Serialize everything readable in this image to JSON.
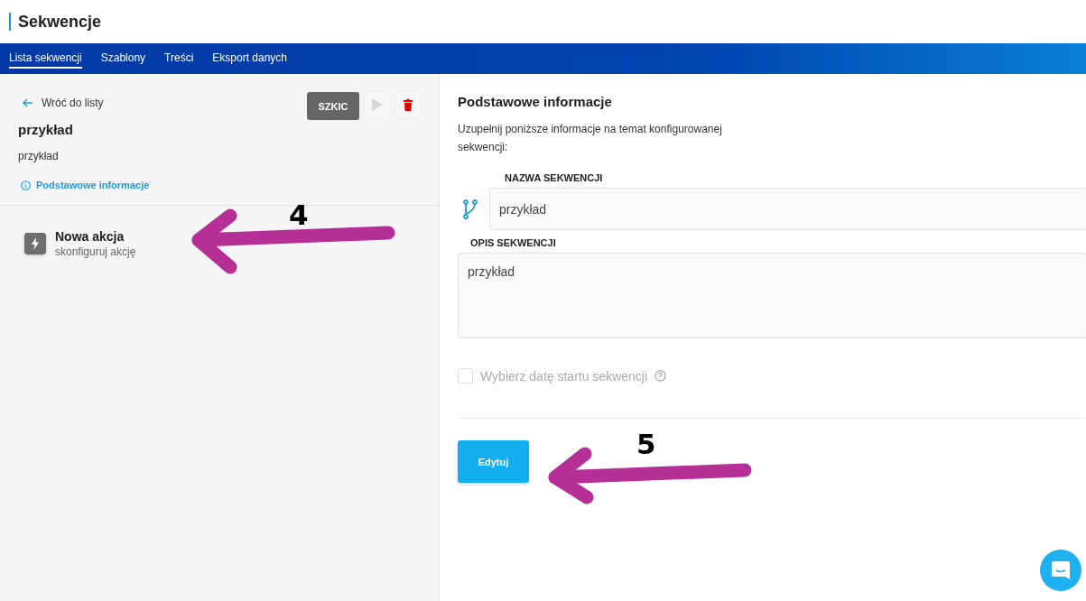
{
  "app": {
    "title": "Sekwencje"
  },
  "nav": [
    {
      "label": "Lista sekwencji",
      "selected": true
    },
    {
      "label": "Szablony",
      "selected": false
    },
    {
      "label": "Treści",
      "selected": false
    },
    {
      "label": "Eksport danych",
      "selected": false
    }
  ],
  "left": {
    "back": "Wróć do listy",
    "status_badge": "SZKIC",
    "play_disabled": true,
    "title": "przykład",
    "description": "przykład",
    "section_link": "Podstawowe informacje",
    "actions": [
      {
        "title": "Nowa akcja",
        "subtitle": "skonfiguruj akcję"
      }
    ]
  },
  "form": {
    "heading": "Podstawowe informacje",
    "intro": "Uzupełnij poniższe informacje na temat konfigurowanej sekwencji:",
    "fields": [
      {
        "kind": "input",
        "label": "NAZWA SEKWENCJI",
        "value": "przykład"
      },
      {
        "kind": "textarea",
        "label": "OPIS SEKWENCJI",
        "value": "przykład"
      }
    ],
    "start_date": {
      "label": "Wybierz datę startu sekwencji",
      "checked": false,
      "disabled": true
    },
    "submit": "Edytuj"
  },
  "annotations": [
    {
      "label": "4"
    },
    {
      "label": "5"
    }
  ]
}
